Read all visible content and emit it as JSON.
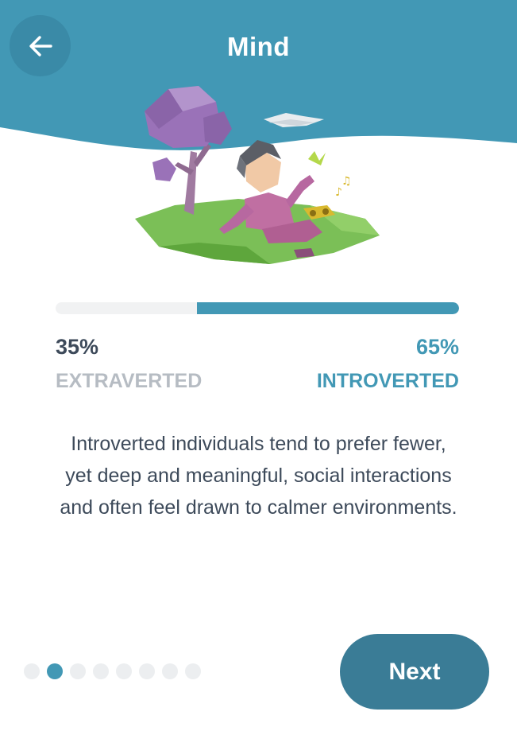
{
  "header": {
    "title": "Mind",
    "back_icon": "arrow-left-icon",
    "color": "#4298b5"
  },
  "trait_scale": {
    "introverted_fraction": 0.65,
    "left": {
      "percent": "35%",
      "label": "EXTRAVERTED"
    },
    "right": {
      "percent": "65%",
      "label": "INTROVERTED"
    },
    "accent_color": "#4298b5"
  },
  "description": {
    "line1": "Introverted individuals tend to prefer fewer,",
    "line2": "yet deep and meaningful, social interactions",
    "line3": "and often feel drawn to calmer environments."
  },
  "pagination": {
    "total": 8,
    "active_index": 1
  },
  "next_button": {
    "label": "Next"
  }
}
